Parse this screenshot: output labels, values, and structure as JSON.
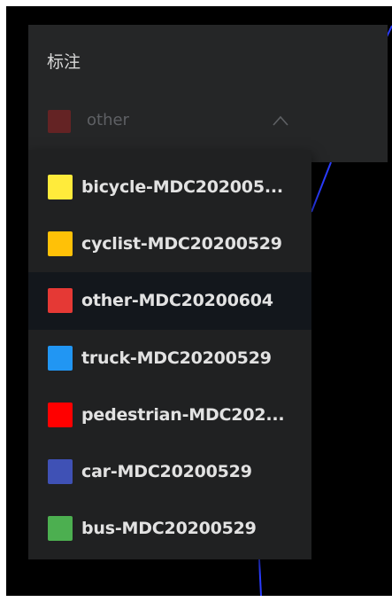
{
  "panel": {
    "title": "标注"
  },
  "select": {
    "value": "other",
    "swatch_color": "#b22222",
    "chevron": "chevron-up-icon"
  },
  "options": [
    {
      "label": "bicycle-MDC202005...",
      "color": "#ffeb3b",
      "selected": false
    },
    {
      "label": "cyclist-MDC20200529",
      "color": "#ffc107",
      "selected": false
    },
    {
      "label": "other-MDC20200604",
      "color": "#e53935",
      "selected": true
    },
    {
      "label": "truck-MDC20200529",
      "color": "#2196f3",
      "selected": false
    },
    {
      "label": "pedestrian-MDC202...",
      "color": "#ff0000",
      "selected": false
    },
    {
      "label": "car-MDC20200529",
      "color": "#3f51b5",
      "selected": false
    },
    {
      "label": "bus-MDC20200529",
      "color": "#4caf50",
      "selected": false
    }
  ]
}
